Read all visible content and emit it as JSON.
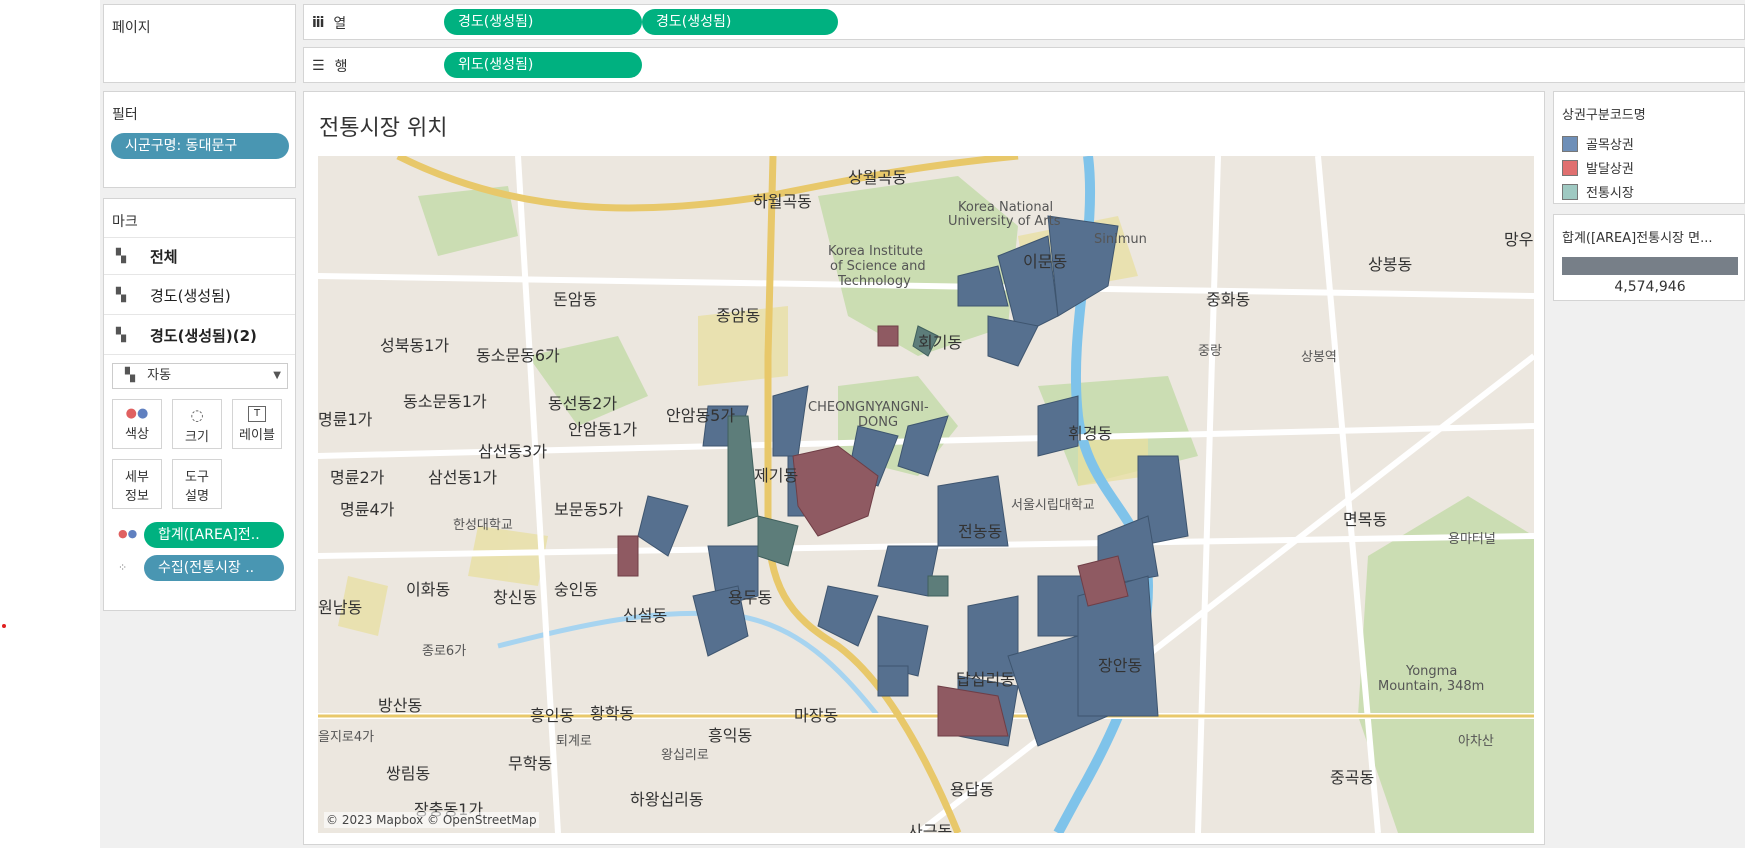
{
  "pages_shelf": {
    "title": "페이지"
  },
  "columns_shelf": {
    "label": "열",
    "pills": [
      "경도(생성됨)",
      "경도(생성됨)"
    ]
  },
  "rows_shelf": {
    "label": "행",
    "pills": [
      "위도(생성됨)"
    ]
  },
  "filters": {
    "title": "필터",
    "pills": [
      "시군구명: 동대문구"
    ]
  },
  "marks": {
    "title": "마크",
    "layers": [
      "전체",
      "경도(생성됨)",
      "경도(생성됨)(2)"
    ],
    "mark_type": "자동",
    "buttons": {
      "color": "색상",
      "size": "크기",
      "label": "레이블",
      "detail_line1": "세부",
      "detail_line2": "정보",
      "tooltip_line1": "도구",
      "tooltip_line2": "설명"
    },
    "field_pills": [
      "합계([AREA]전..",
      "수집(전통시장 .."
    ]
  },
  "view": {
    "title": "전통시장 위치",
    "attribution": "© 2023 Mapbox © OpenStreetMap"
  },
  "legend_color": {
    "title": "상권구분코드명",
    "items": [
      {
        "label": "골목상권",
        "color": "#6e8fb8"
      },
      {
        "label": "발달상권",
        "color": "#e07070"
      },
      {
        "label": "전통시장",
        "color": "#9fc9c2"
      }
    ]
  },
  "legend_size": {
    "title": "합계([AREA]전통시장 면...",
    "value": "4,574,946"
  },
  "map_labels": [
    "상월곡동",
    "하월곡동",
    "Korea National",
    "University of Arts",
    "Korea Institute",
    "of Science and",
    "Technology",
    "이문동",
    "돈암동",
    "종암동",
    "중화동",
    "상봉동",
    "회기동",
    "성북동1가",
    "동소문동6가",
    "동소문동1가",
    "동선동2가",
    "안암동1가",
    "안암동5가",
    "CHEONGNYANGNI-",
    "DONG",
    "휘경동",
    "명륜1가",
    "명륜2가",
    "삼선동3가",
    "삼선동1가",
    "명륜4가",
    "보문동5가",
    "제기동",
    "서울시립대학교",
    "전농동",
    "면목동",
    "용마터널",
    "한성대학교",
    "이화동",
    "창신동",
    "숭인동",
    "신설동",
    "용두동",
    "원남동",
    "종로6가",
    "답십리동",
    "장안동",
    "Yongma",
    "Mountain, 348m",
    "방산동",
    "흥인동",
    "황학동",
    "마장동",
    "을지로4가",
    "퇴계로",
    "흥익동",
    "왕십리로",
    "쌍림동",
    "무학동",
    "하왕십리동",
    "용답동",
    "중곡동",
    "아차산",
    "장충동1가",
    "사근동",
    "중랑",
    "상봉역",
    "망우",
    "Sinimun"
  ]
}
